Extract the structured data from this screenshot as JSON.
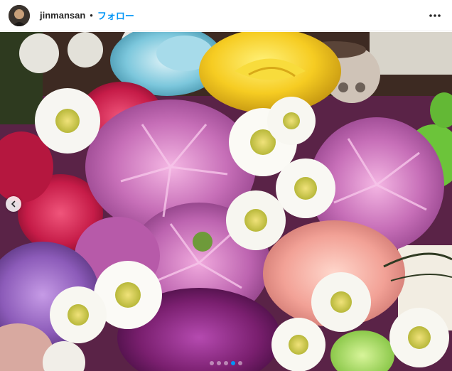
{
  "header": {
    "username": "jinmansan",
    "separator": "•",
    "follow_label": "フォロー",
    "more_icon": "more-horizontal-icon"
  },
  "carousel": {
    "slide_count": 5,
    "active_index": 3,
    "prev_icon": "chevron-left-icon"
  },
  "colors": {
    "follow": "#0095f6",
    "text": "#262626",
    "border": "#efefef"
  }
}
